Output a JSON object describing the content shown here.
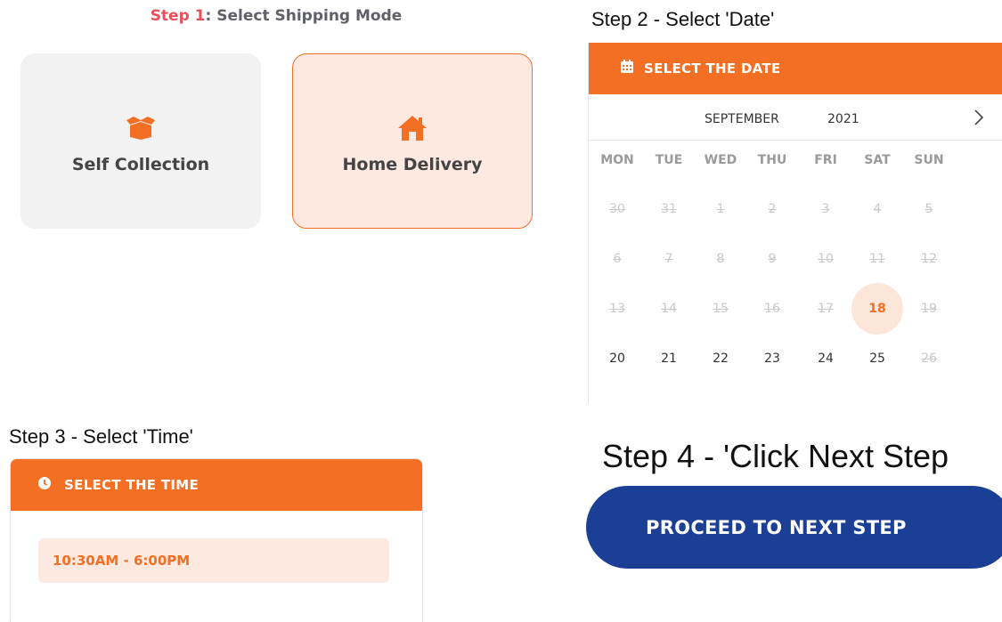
{
  "step1": {
    "label_prefix": "Step 1",
    "label_rest": ": Select Shipping Mode",
    "options": [
      {
        "label": "Self Collection",
        "icon": "box-icon",
        "selected": false
      },
      {
        "label": "Home Delivery",
        "icon": "house-icon",
        "selected": true
      }
    ]
  },
  "step2": {
    "heading": "Step 2 - Select 'Date'",
    "header_title": "SELECT THE DATE",
    "header_icon": "calendar-icon",
    "month": "SEPTEMBER",
    "year": "2021",
    "next_icon": "chevron-right-icon",
    "weekdays": [
      "MON",
      "TUE",
      "WED",
      "THU",
      "FRI",
      "SAT",
      "SUN"
    ],
    "weeks": [
      [
        {
          "d": "30",
          "s": "disabled"
        },
        {
          "d": "31",
          "s": "disabled"
        },
        {
          "d": "1",
          "s": "disabled"
        },
        {
          "d": "2",
          "s": "disabled"
        },
        {
          "d": "3",
          "s": "disabled"
        },
        {
          "d": "4",
          "s": "disabled"
        },
        {
          "d": "5",
          "s": "disabled"
        }
      ],
      [
        {
          "d": "6",
          "s": "disabled"
        },
        {
          "d": "7",
          "s": "disabled"
        },
        {
          "d": "8",
          "s": "disabled"
        },
        {
          "d": "9",
          "s": "disabled"
        },
        {
          "d": "10",
          "s": "disabled"
        },
        {
          "d": "11",
          "s": "disabled"
        },
        {
          "d": "12",
          "s": "disabled"
        }
      ],
      [
        {
          "d": "13",
          "s": "disabled"
        },
        {
          "d": "14",
          "s": "disabled"
        },
        {
          "d": "15",
          "s": "disabled"
        },
        {
          "d": "16",
          "s": "disabled"
        },
        {
          "d": "17",
          "s": "disabled"
        },
        {
          "d": "18",
          "s": "selected"
        },
        {
          "d": "19",
          "s": "disabled"
        }
      ],
      [
        {
          "d": "20",
          "s": "enabled"
        },
        {
          "d": "21",
          "s": "enabled"
        },
        {
          "d": "22",
          "s": "enabled"
        },
        {
          "d": "23",
          "s": "enabled"
        },
        {
          "d": "24",
          "s": "enabled"
        },
        {
          "d": "25",
          "s": "enabled"
        },
        {
          "d": "26",
          "s": "disabled"
        }
      ]
    ]
  },
  "step3": {
    "heading": "Step 3 - Select 'Time'",
    "header_title": "SELECT THE TIME",
    "header_icon": "clock-icon",
    "slot": "10:30AM - 6:00PM"
  },
  "step4": {
    "heading": "Step 4 - 'Click Next Step",
    "button_label": "PROCEED TO NEXT STEP"
  },
  "colors": {
    "accent_orange": "#f26f23",
    "selected_bg": "#fde9e0",
    "step_red": "#e8505b",
    "button_blue": "#1a3f95"
  }
}
